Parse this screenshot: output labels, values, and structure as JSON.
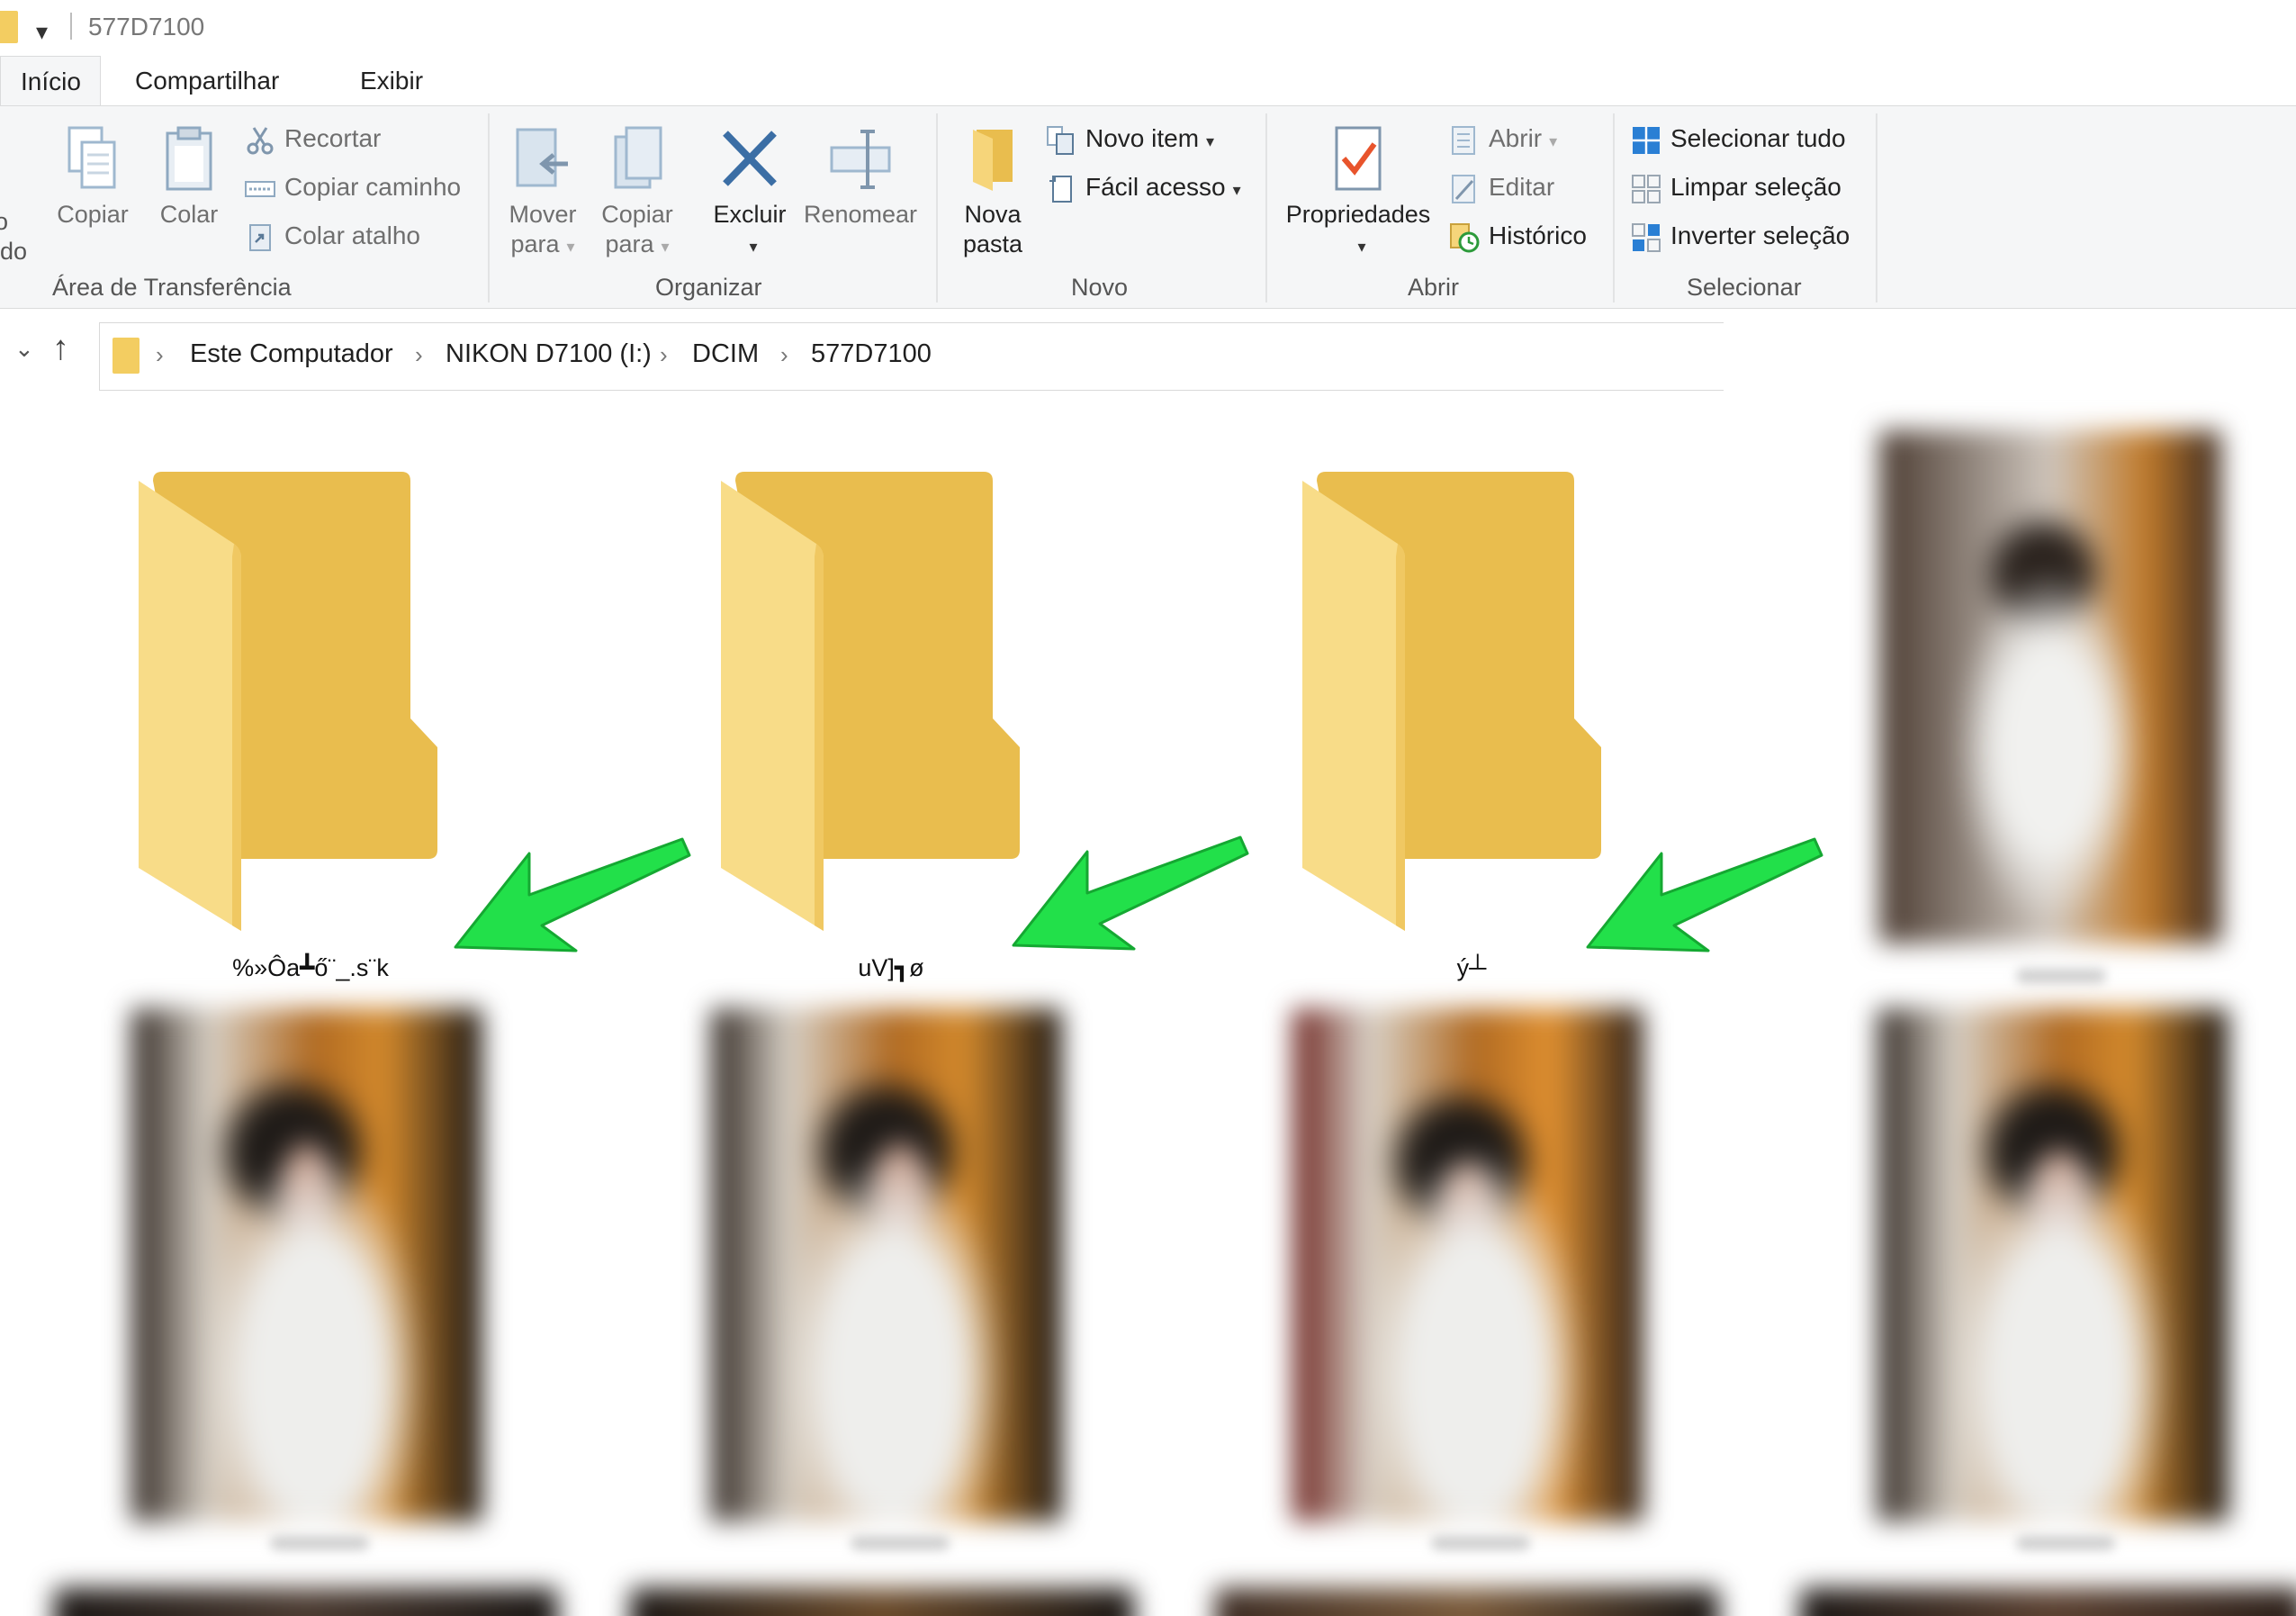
{
  "window": {
    "title": "577D7100",
    "quick_access_caret": "▾"
  },
  "tabs": [
    {
      "label": "Início",
      "active": true
    },
    {
      "label": "Compartilhar",
      "active": false
    },
    {
      "label": "Exibir",
      "active": false
    }
  ],
  "ribbon": {
    "clipboard": {
      "group_label": "Área de Transferência",
      "pin_label_line1": "o",
      "pin_label_line2": "ido",
      "copy_label": "Copiar",
      "paste_label": "Colar",
      "cut_label": "Recortar",
      "copy_path_label": "Copiar caminho",
      "paste_shortcut_label": "Colar atalho"
    },
    "organize": {
      "group_label": "Organizar",
      "move_line1": "Mover",
      "move_line2": "para",
      "copyto_line1": "Copiar",
      "copyto_line2": "para",
      "delete_label": "Excluir",
      "rename_label": "Renomear"
    },
    "new": {
      "group_label": "Novo",
      "new_folder_line1": "Nova",
      "new_folder_line2": "pasta",
      "new_item_label": "Novo item",
      "easy_access_label": "Fácil acesso"
    },
    "open": {
      "group_label": "Abrir",
      "properties_label": "Propriedades",
      "open_label": "Abrir",
      "edit_label": "Editar",
      "history_label": "Histórico"
    },
    "select": {
      "group_label": "Selecionar",
      "select_all_label": "Selecionar tudo",
      "select_none_label": "Limpar seleção",
      "invert_label": "Inverter seleção"
    }
  },
  "address_bar": {
    "breadcrumbs": [
      "Este Computador",
      "NIKON D7100 (I:)",
      "DCIM",
      "577D7100"
    ]
  },
  "folders": [
    {
      "name": "%»Ôa┻ő¨_.s¨k"
    },
    {
      "name": "uV]┓ø"
    },
    {
      "name": "ý┴"
    }
  ],
  "colors": {
    "folder_front": "#f6d57a",
    "folder_back": "#e9bd4e",
    "arrow_green": "#22e04a",
    "ribbon_bg": "#f5f6f7",
    "select_icon_blue": "#2a7fd4"
  },
  "icons": {
    "delete": "x-mark-icon",
    "properties": "checkmark-document-icon",
    "up": "up-arrow-icon"
  }
}
